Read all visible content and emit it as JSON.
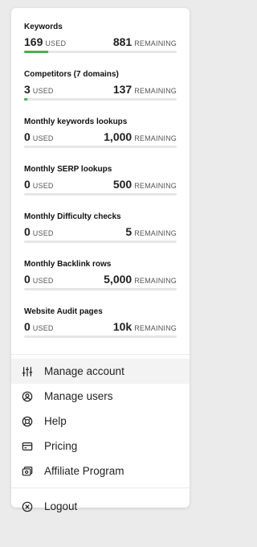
{
  "usage": [
    {
      "title": "Keywords",
      "used": "169",
      "used_label": "USED",
      "remaining": "881",
      "remaining_label": "REMAINING",
      "progress": 0.16
    },
    {
      "title": "Competitors (7 domains)",
      "used": "3",
      "used_label": "USED",
      "remaining": "137",
      "remaining_label": "REMAINING",
      "progress": 0.02
    },
    {
      "title": "Monthly keywords lookups",
      "used": "0",
      "used_label": "USED",
      "remaining": "1,000",
      "remaining_label": "REMAINING",
      "progress": 0
    },
    {
      "title": "Monthly SERP lookups",
      "used": "0",
      "used_label": "USED",
      "remaining": "500",
      "remaining_label": "REMAINING",
      "progress": 0
    },
    {
      "title": "Monthly Difficulty checks",
      "used": "0",
      "used_label": "USED",
      "remaining": "5",
      "remaining_label": "REMAINING",
      "progress": 0
    },
    {
      "title": "Monthly Backlink rows",
      "used": "0",
      "used_label": "USED",
      "remaining": "5,000",
      "remaining_label": "REMAINING",
      "progress": 0
    },
    {
      "title": "Website Audit pages",
      "used": "0",
      "used_label": "USED",
      "remaining": "10k",
      "remaining_label": "REMAINING",
      "progress": 0
    }
  ],
  "menu": [
    {
      "label": "Manage account",
      "icon": "sliders-icon"
    },
    {
      "label": "Manage users",
      "icon": "user-circle-icon"
    },
    {
      "label": "Help",
      "icon": "lifebuoy-icon"
    },
    {
      "label": "Pricing",
      "icon": "credit-card-icon"
    },
    {
      "label": "Affiliate Program",
      "icon": "cards-icon"
    }
  ],
  "logout": {
    "label": "Logout",
    "icon": "close-circle-icon"
  },
  "colors": {
    "progress": "#4caf50",
    "track": "#e6e6e6",
    "active_item": "#f3f3f3"
  }
}
